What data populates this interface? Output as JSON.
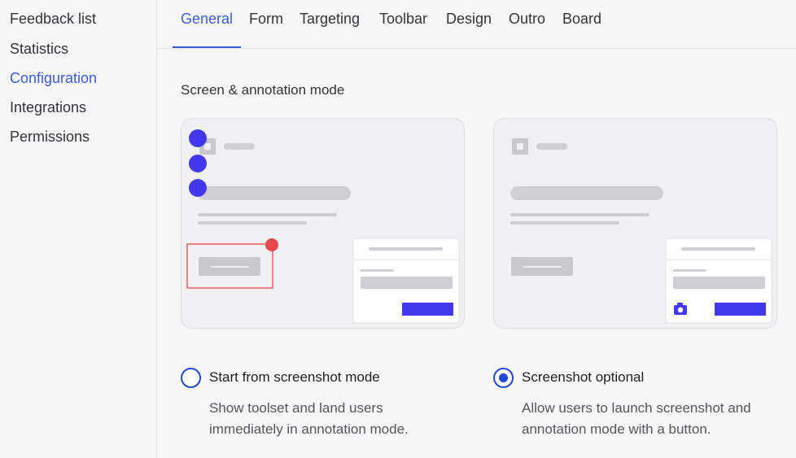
{
  "sidebar": {
    "items": [
      {
        "label": "Feedback list",
        "active": false
      },
      {
        "label": "Statistics",
        "active": false
      },
      {
        "label": "Configuration",
        "active": true
      },
      {
        "label": "Integrations",
        "active": false
      },
      {
        "label": "Permissions",
        "active": false
      }
    ]
  },
  "tabs": [
    {
      "label": "General",
      "active": true
    },
    {
      "label": "Form",
      "active": false
    },
    {
      "label": "Targeting",
      "active": false
    },
    {
      "label": "Toolbar",
      "active": false
    },
    {
      "label": "Design",
      "active": false
    },
    {
      "label": "Outro",
      "active": false
    },
    {
      "label": "Board",
      "active": false
    }
  ],
  "section": {
    "title": "Screen & annotation mode"
  },
  "options": [
    {
      "title": "Start from screenshot mode",
      "description": "Show toolset and land users immediately in annotation mode.",
      "selected": false
    },
    {
      "title": "Screenshot optional",
      "description": "Allow users to launch screenshot and annotation mode with a button.",
      "selected": true
    }
  ],
  "colors": {
    "accent": "#3b5bdb",
    "toolbar_dot": "#4338ec",
    "annotation_red": "#e5484d",
    "radio": "#2347d9"
  },
  "icons": {
    "camera": "camera-icon"
  }
}
